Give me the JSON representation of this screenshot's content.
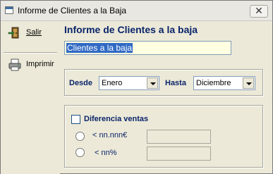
{
  "window": {
    "title": "Informe de Clientes a la Baja",
    "close_glyph": "✕"
  },
  "sidebar": {
    "salir": {
      "label": "Salir",
      "icon": "exit-door-icon"
    },
    "imprimir": {
      "label": "Imprimir",
      "icon": "printer-icon"
    }
  },
  "main": {
    "heading": "Informe de Clientes a la baja",
    "report_title_value": "Clientes a la baja",
    "desde_label": "Desde",
    "desde_value": "Enero",
    "hasta_label": "Hasta",
    "hasta_value": "Diciembre",
    "diferencia_label": "Diferencia ventas",
    "option_amount_label": "< nn.nnn€",
    "option_percent_label": "< nn%",
    "option_amount_value": "",
    "option_percent_value": ""
  },
  "colors": {
    "label_blue": "#0A246A",
    "highlight_input": "#FFFFE1",
    "selection": "#316AC5"
  }
}
